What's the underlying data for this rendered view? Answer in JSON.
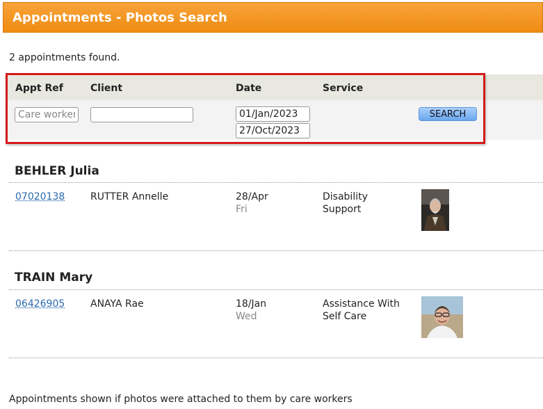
{
  "header": {
    "title": "Appointments - Photos Search"
  },
  "summary": "2 appointments found.",
  "filters": {
    "columns": [
      "Appt Ref",
      "Client",
      "Date",
      "Service"
    ],
    "appt_ref_placeholder": "Care worker",
    "client_value": "",
    "date_from": "01/Jan/2023",
    "date_to": "27/Oct/2023",
    "search_label": "SEARCH"
  },
  "groups": [
    {
      "worker": "BEHLER Julia",
      "appointment": {
        "ref": "07020138",
        "client": "RUTTER Annelle",
        "date": "28/Apr",
        "day": "Fri",
        "service_line1": "Disability",
        "service_line2": "Support"
      }
    },
    {
      "worker": "TRAIN Mary",
      "appointment": {
        "ref": "06426905",
        "client": "ANAYA Rae",
        "date": "18/Jan",
        "day": "Wed",
        "service_line1": "Assistance With",
        "service_line2": "Self Care"
      }
    }
  ],
  "footer": "Appointments shown if photos were attached to them by care workers",
  "colors": {
    "header": "#f08c12",
    "highlight_border": "#d41a1a",
    "link": "#2a6ab0",
    "button": "#6aa7ee"
  }
}
